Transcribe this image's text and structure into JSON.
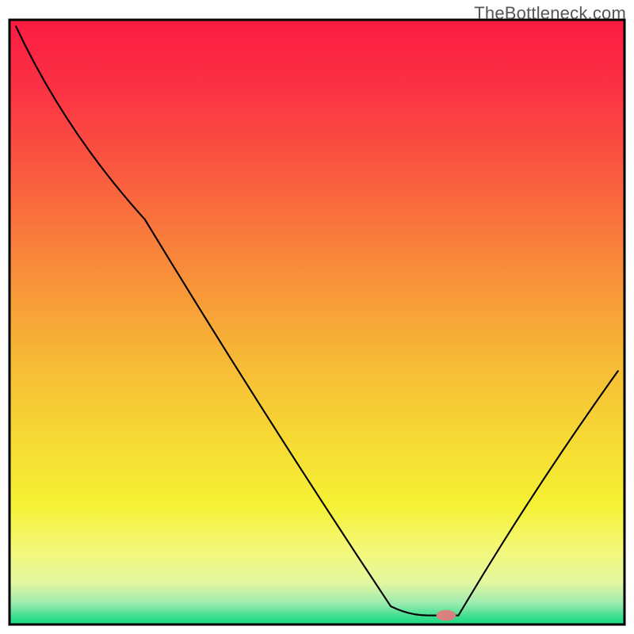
{
  "watermark": "TheBottleneck.com",
  "colors": {
    "frame": "#000000",
    "curve": "#000000",
    "marker_fill": "#d8817f",
    "gradient_stops": [
      {
        "offset": 0.0,
        "color": "#fb1b42"
      },
      {
        "offset": 0.12,
        "color": "#fb3344"
      },
      {
        "offset": 0.25,
        "color": "#fa5a3f"
      },
      {
        "offset": 0.4,
        "color": "#f8883a"
      },
      {
        "offset": 0.55,
        "color": "#f7b636"
      },
      {
        "offset": 0.7,
        "color": "#f6db34"
      },
      {
        "offset": 0.8,
        "color": "#f5f133"
      },
      {
        "offset": 0.88,
        "color": "#f4f87c"
      },
      {
        "offset": 0.93,
        "color": "#e4f79f"
      },
      {
        "offset": 0.965,
        "color": "#9cebb0"
      },
      {
        "offset": 0.99,
        "color": "#30dc8b"
      },
      {
        "offset": 1.0,
        "color": "#1fd983"
      }
    ]
  },
  "chart_data": {
    "type": "line",
    "title": "",
    "xlabel": "",
    "ylabel": "",
    "xlim": [
      0,
      100
    ],
    "ylim": [
      0,
      100
    ],
    "curve_points": [
      {
        "x": 1.0,
        "y": 99.0
      },
      {
        "x": 22.0,
        "y": 67.0
      },
      {
        "x": 62.0,
        "y": 3.0
      },
      {
        "x": 68.0,
        "y": 1.5
      },
      {
        "x": 73.0,
        "y": 1.5
      },
      {
        "x": 99.0,
        "y": 42.0
      }
    ],
    "marker": {
      "x": 71.0,
      "y": 1.5,
      "rx_pct": 1.6,
      "ry_pct": 0.9
    },
    "notes": "Upper curve segment is slightly convex; lower-left run is nearly linear; minimum is a short flat plateau around x≈68–73; right branch rises roughly linearly."
  }
}
